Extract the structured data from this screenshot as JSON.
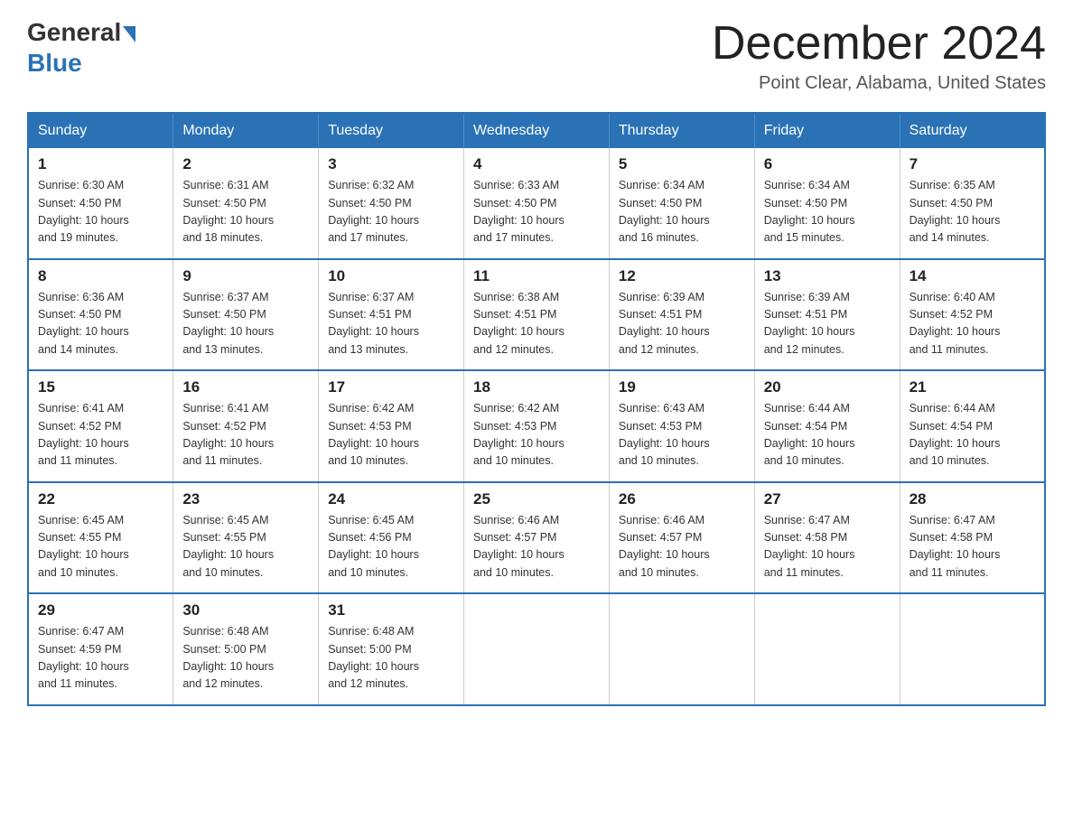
{
  "header": {
    "logo_general": "General",
    "logo_blue": "Blue",
    "month_title": "December 2024",
    "location": "Point Clear, Alabama, United States"
  },
  "weekdays": [
    "Sunday",
    "Monday",
    "Tuesday",
    "Wednesday",
    "Thursday",
    "Friday",
    "Saturday"
  ],
  "weeks": [
    [
      {
        "day": "1",
        "sunrise": "6:30 AM",
        "sunset": "4:50 PM",
        "daylight": "10 hours and 19 minutes."
      },
      {
        "day": "2",
        "sunrise": "6:31 AM",
        "sunset": "4:50 PM",
        "daylight": "10 hours and 18 minutes."
      },
      {
        "day": "3",
        "sunrise": "6:32 AM",
        "sunset": "4:50 PM",
        "daylight": "10 hours and 17 minutes."
      },
      {
        "day": "4",
        "sunrise": "6:33 AM",
        "sunset": "4:50 PM",
        "daylight": "10 hours and 17 minutes."
      },
      {
        "day": "5",
        "sunrise": "6:34 AM",
        "sunset": "4:50 PM",
        "daylight": "10 hours and 16 minutes."
      },
      {
        "day": "6",
        "sunrise": "6:34 AM",
        "sunset": "4:50 PM",
        "daylight": "10 hours and 15 minutes."
      },
      {
        "day": "7",
        "sunrise": "6:35 AM",
        "sunset": "4:50 PM",
        "daylight": "10 hours and 14 minutes."
      }
    ],
    [
      {
        "day": "8",
        "sunrise": "6:36 AM",
        "sunset": "4:50 PM",
        "daylight": "10 hours and 14 minutes."
      },
      {
        "day": "9",
        "sunrise": "6:37 AM",
        "sunset": "4:50 PM",
        "daylight": "10 hours and 13 minutes."
      },
      {
        "day": "10",
        "sunrise": "6:37 AM",
        "sunset": "4:51 PM",
        "daylight": "10 hours and 13 minutes."
      },
      {
        "day": "11",
        "sunrise": "6:38 AM",
        "sunset": "4:51 PM",
        "daylight": "10 hours and 12 minutes."
      },
      {
        "day": "12",
        "sunrise": "6:39 AM",
        "sunset": "4:51 PM",
        "daylight": "10 hours and 12 minutes."
      },
      {
        "day": "13",
        "sunrise": "6:39 AM",
        "sunset": "4:51 PM",
        "daylight": "10 hours and 12 minutes."
      },
      {
        "day": "14",
        "sunrise": "6:40 AM",
        "sunset": "4:52 PM",
        "daylight": "10 hours and 11 minutes."
      }
    ],
    [
      {
        "day": "15",
        "sunrise": "6:41 AM",
        "sunset": "4:52 PM",
        "daylight": "10 hours and 11 minutes."
      },
      {
        "day": "16",
        "sunrise": "6:41 AM",
        "sunset": "4:52 PM",
        "daylight": "10 hours and 11 minutes."
      },
      {
        "day": "17",
        "sunrise": "6:42 AM",
        "sunset": "4:53 PM",
        "daylight": "10 hours and 10 minutes."
      },
      {
        "day": "18",
        "sunrise": "6:42 AM",
        "sunset": "4:53 PM",
        "daylight": "10 hours and 10 minutes."
      },
      {
        "day": "19",
        "sunrise": "6:43 AM",
        "sunset": "4:53 PM",
        "daylight": "10 hours and 10 minutes."
      },
      {
        "day": "20",
        "sunrise": "6:44 AM",
        "sunset": "4:54 PM",
        "daylight": "10 hours and 10 minutes."
      },
      {
        "day": "21",
        "sunrise": "6:44 AM",
        "sunset": "4:54 PM",
        "daylight": "10 hours and 10 minutes."
      }
    ],
    [
      {
        "day": "22",
        "sunrise": "6:45 AM",
        "sunset": "4:55 PM",
        "daylight": "10 hours and 10 minutes."
      },
      {
        "day": "23",
        "sunrise": "6:45 AM",
        "sunset": "4:55 PM",
        "daylight": "10 hours and 10 minutes."
      },
      {
        "day": "24",
        "sunrise": "6:45 AM",
        "sunset": "4:56 PM",
        "daylight": "10 hours and 10 minutes."
      },
      {
        "day": "25",
        "sunrise": "6:46 AM",
        "sunset": "4:57 PM",
        "daylight": "10 hours and 10 minutes."
      },
      {
        "day": "26",
        "sunrise": "6:46 AM",
        "sunset": "4:57 PM",
        "daylight": "10 hours and 10 minutes."
      },
      {
        "day": "27",
        "sunrise": "6:47 AM",
        "sunset": "4:58 PM",
        "daylight": "10 hours and 11 minutes."
      },
      {
        "day": "28",
        "sunrise": "6:47 AM",
        "sunset": "4:58 PM",
        "daylight": "10 hours and 11 minutes."
      }
    ],
    [
      {
        "day": "29",
        "sunrise": "6:47 AM",
        "sunset": "4:59 PM",
        "daylight": "10 hours and 11 minutes."
      },
      {
        "day": "30",
        "sunrise": "6:48 AM",
        "sunset": "5:00 PM",
        "daylight": "10 hours and 12 minutes."
      },
      {
        "day": "31",
        "sunrise": "6:48 AM",
        "sunset": "5:00 PM",
        "daylight": "10 hours and 12 minutes."
      },
      null,
      null,
      null,
      null
    ]
  ],
  "labels": {
    "sunrise_prefix": "Sunrise: ",
    "sunset_prefix": "Sunset: ",
    "daylight_prefix": "Daylight: "
  }
}
